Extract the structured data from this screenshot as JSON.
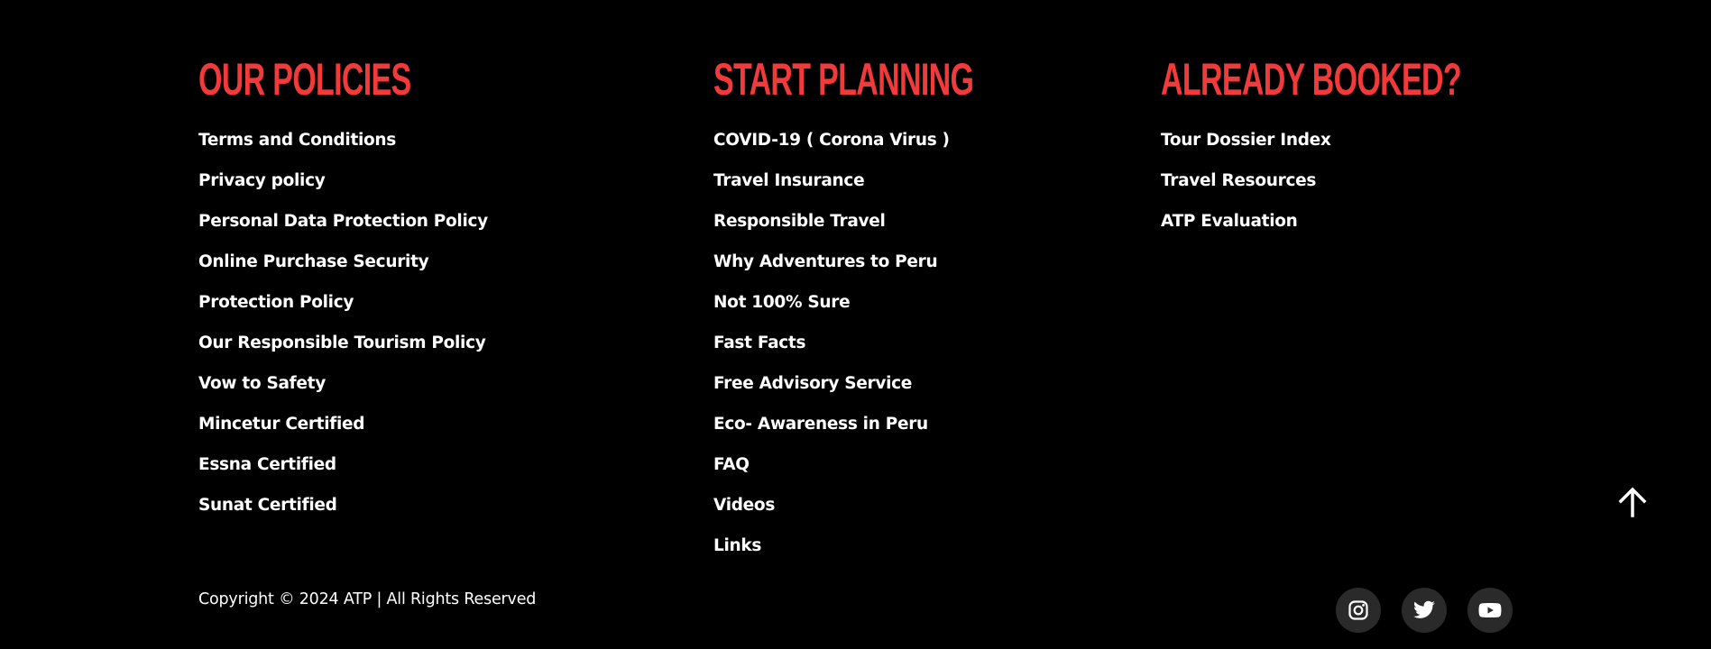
{
  "columns": {
    "policies": {
      "heading": "OUR POLICIES",
      "links": [
        "Terms and Conditions",
        "Privacy policy",
        "Personal Data Protection Policy",
        "Online Purchase Security",
        "Protection Policy",
        "Our Responsible Tourism Policy",
        "Vow to Safety",
        "Mincetur Certified",
        "Essna Certified",
        "Sunat Certified"
      ]
    },
    "planning": {
      "heading": "START PLANNING",
      "links": [
        "COVID-19 ( Corona Virus )",
        "Travel Insurance",
        "Responsible Travel",
        "Why Adventures to Peru",
        "Not 100% Sure",
        "Fast Facts",
        "Free Advisory Service",
        "Eco- Awareness in Peru",
        "FAQ",
        "Videos",
        "Links"
      ]
    },
    "booked": {
      "heading": "ALREADY BOOKED?",
      "links": [
        "Tour Dossier Index",
        "Travel Resources",
        "ATP Evaluation"
      ]
    }
  },
  "copyright": "Copyright © 2024 ATP | All Rights Reserved",
  "social": [
    {
      "icon": "instagram-icon"
    },
    {
      "icon": "twitter-icon"
    },
    {
      "icon": "youtube-icon"
    }
  ],
  "scroll_top": {
    "icon": "arrow-up-icon"
  },
  "colors": {
    "background": "#000000",
    "heading": "#f23a3a",
    "text": "#ffffff",
    "social_bg": "#2a2a2a"
  }
}
